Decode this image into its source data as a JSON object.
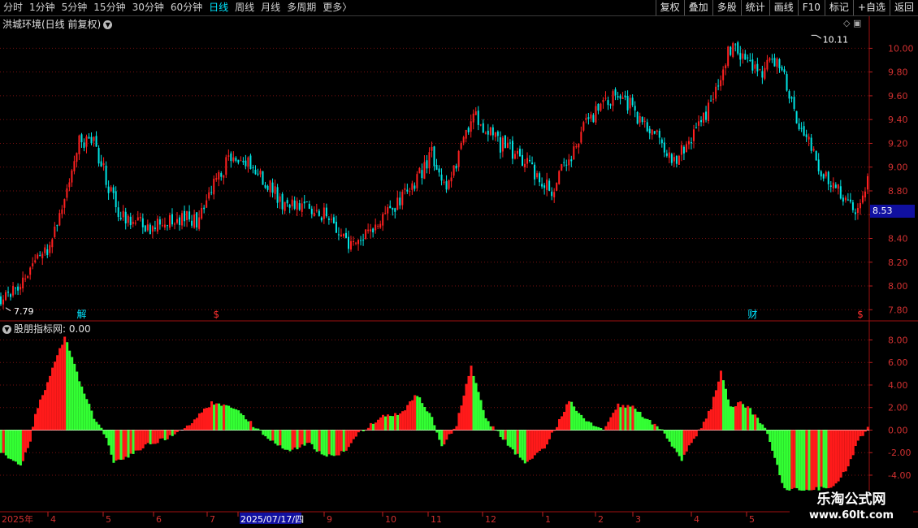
{
  "toolbar": {
    "periods": [
      "分时",
      "1分钟",
      "5分钟",
      "15分钟",
      "30分钟",
      "60分钟",
      "日线",
      "周线",
      "月线",
      "多周期",
      "更多"
    ],
    "active_period": "日线",
    "more_arrow": "〉",
    "buttons": [
      "复权",
      "叠加",
      "多股",
      "统计",
      "画线",
      "F10",
      "标记",
      "+自选",
      "返回"
    ]
  },
  "main_panel": {
    "title": "洪城环境(日线 前复权)",
    "current_price": "8.53",
    "max_label": "10.11",
    "min_label": "7.79",
    "markers": [
      {
        "text": "解",
        "color": "#00e5ff"
      },
      {
        "text": "$",
        "color": "#ff3030"
      },
      {
        "text": "财",
        "color": "#00e5ff"
      },
      {
        "text": "$",
        "color": "#ff3030"
      }
    ]
  },
  "sub_panel": {
    "title": "股朋指标网",
    "value_text": ": 0.00"
  },
  "watermark": {
    "line1": "乐淘公式网",
    "line2": "www.60lt.com"
  },
  "chart_data": [
    {
      "type": "candlestick",
      "title": "洪城环境(日线 前复权)",
      "ylim": [
        7.72,
        10.16
      ],
      "yticks": [
        "10.00",
        "9.80",
        "9.60",
        "9.40",
        "9.20",
        "9.00",
        "8.80",
        "8.60",
        "8.40",
        "8.20",
        "8.00",
        "7.80"
      ],
      "x_labels": [
        "2025年",
        "4",
        "5",
        "6",
        "7",
        "2025/07/17/四",
        "9",
        "10",
        "11",
        "12",
        "1",
        "2",
        "3",
        "4",
        "5"
      ],
      "close_path": [
        [
          0,
          7.9
        ],
        [
          10,
          8.05
        ],
        [
          20,
          8.35
        ],
        [
          32,
          9.2
        ],
        [
          38,
          9.22
        ],
        [
          48,
          8.6
        ],
        [
          60,
          8.5
        ],
        [
          73,
          8.57
        ],
        [
          80,
          8.55
        ],
        [
          93,
          9.08
        ],
        [
          102,
          9.05
        ],
        [
          115,
          8.7
        ],
        [
          133,
          8.6
        ],
        [
          143,
          8.34
        ],
        [
          163,
          8.7
        ],
        [
          176,
          9.1
        ],
        [
          183,
          8.82
        ],
        [
          193,
          9.45
        ],
        [
          203,
          9.2
        ],
        [
          212,
          9.1
        ],
        [
          225,
          8.8
        ],
        [
          240,
          9.4
        ],
        [
          253,
          9.62
        ],
        [
          262,
          9.38
        ],
        [
          276,
          9.05
        ],
        [
          289,
          9.5
        ],
        [
          298,
          10.0
        ],
        [
          310,
          9.8
        ],
        [
          318,
          9.9
        ],
        [
          326,
          9.35
        ],
        [
          336,
          8.95
        ],
        [
          350,
          8.65
        ],
        [
          354,
          8.9
        ]
      ],
      "max_price": 10.11,
      "min_price": 7.79,
      "last_price": 8.53
    },
    {
      "type": "bar",
      "title": "股朋指标网",
      "ylim": [
        -5.3,
        8.9
      ],
      "yticks": [
        "8.00",
        "6.00",
        "4.00",
        "2.00",
        "0.00",
        "-2.00",
        "-4.00"
      ],
      "colors": {
        "up": "#ff1a1a",
        "down": "#33ff33"
      },
      "wave_path": [
        [
          0,
          -2.0
        ],
        [
          8,
          -3.2
        ],
        [
          12,
          -1.0
        ],
        [
          14,
          1.5
        ],
        [
          20,
          4.8
        ],
        [
          26,
          8.3
        ],
        [
          32,
          4.5
        ],
        [
          38,
          1.0
        ],
        [
          42,
          -0.2
        ],
        [
          46,
          -2.8
        ],
        [
          52,
          -2.3
        ],
        [
          60,
          -1.3
        ],
        [
          70,
          -0.5
        ],
        [
          78,
          0.7
        ],
        [
          86,
          2.4
        ],
        [
          96,
          2.0
        ],
        [
          104,
          0.2
        ],
        [
          110,
          -1.0
        ],
        [
          118,
          -1.8
        ],
        [
          126,
          -1.2
        ],
        [
          132,
          -2.3
        ],
        [
          140,
          -2.0
        ],
        [
          146,
          -0.3
        ],
        [
          156,
          1.3
        ],
        [
          163,
          1.4
        ],
        [
          170,
          3.2
        ],
        [
          176,
          1.0
        ],
        [
          180,
          -1.5
        ],
        [
          186,
          0.5
        ],
        [
          192,
          5.7
        ],
        [
          198,
          1.0
        ],
        [
          204,
          -0.5
        ],
        [
          210,
          -2.0
        ],
        [
          214,
          -3.0
        ],
        [
          222,
          -1.5
        ],
        [
          228,
          0.8
        ],
        [
          232,
          2.6
        ],
        [
          240,
          0.6
        ],
        [
          246,
          0.0
        ],
        [
          252,
          2.2
        ],
        [
          258,
          2.0
        ],
        [
          264,
          1.0
        ],
        [
          270,
          0.0
        ],
        [
          278,
          -2.8
        ],
        [
          282,
          -1.0
        ],
        [
          286,
          0.2
        ],
        [
          290,
          2.0
        ],
        [
          294,
          5.3
        ],
        [
          298,
          2.0
        ],
        [
          302,
          2.5
        ],
        [
          306,
          1.8
        ],
        [
          312,
          0.2
        ],
        [
          316,
          -2.5
        ],
        [
          320,
          -5.2
        ],
        [
          330,
          -5.3
        ],
        [
          340,
          -5.0
        ],
        [
          346,
          -3.2
        ],
        [
          350,
          -1.0
        ],
        [
          354,
          0.3
        ]
      ]
    }
  ]
}
